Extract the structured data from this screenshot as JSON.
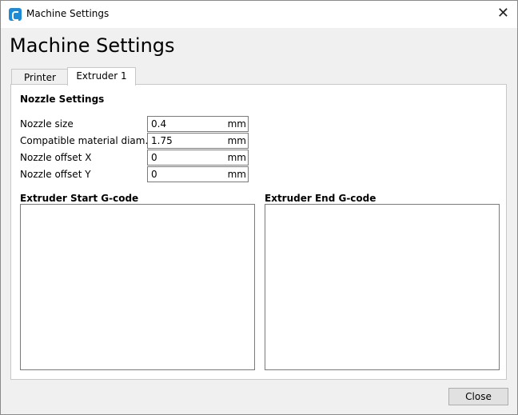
{
  "window": {
    "title": "Machine Settings",
    "close_glyph": "✕",
    "icon": "cura-logo-icon"
  },
  "heading": "Machine Settings",
  "tabs": [
    {
      "label": "Printer",
      "active": false
    },
    {
      "label": "Extruder 1",
      "active": true
    }
  ],
  "nozzle": {
    "title": "Nozzle Settings",
    "fields": [
      {
        "label": "Nozzle size",
        "value": "0.4",
        "unit": "mm"
      },
      {
        "label": "Compatible material diam...",
        "value": "1.75",
        "unit": "mm"
      },
      {
        "label": "Nozzle offset X",
        "value": "0",
        "unit": "mm"
      },
      {
        "label": "Nozzle offset Y",
        "value": "0",
        "unit": "mm"
      }
    ]
  },
  "gcode": {
    "start_label": "Extruder Start G-code",
    "start_value": "",
    "end_label": "Extruder End G-code",
    "end_value": ""
  },
  "footer": {
    "close_label": "Close"
  },
  "colors": {
    "accent": "#1e8bd6"
  }
}
